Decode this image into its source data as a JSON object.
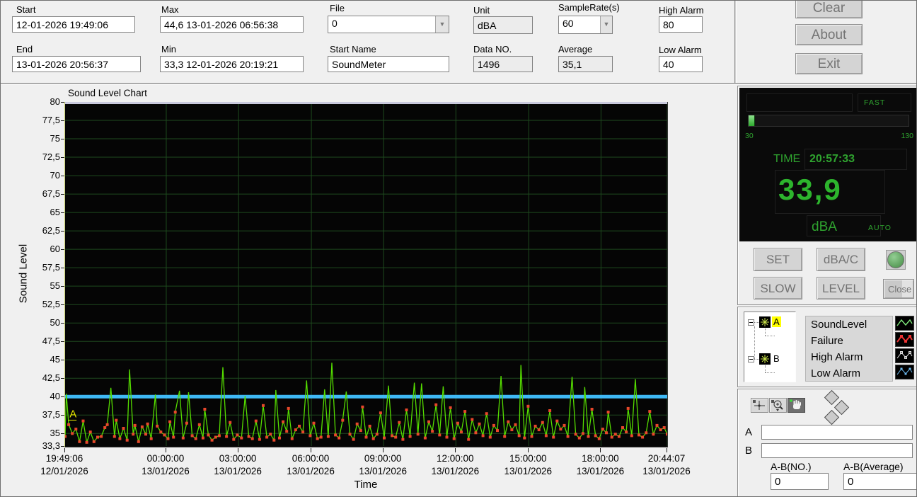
{
  "topbar": {
    "fields": {
      "start": {
        "label": "Start",
        "value": "12-01-2026 19:49:06"
      },
      "end": {
        "label": "End",
        "value": "13-01-2026 20:56:37"
      },
      "max": {
        "label": "Max",
        "value": "44,6 13-01-2026 06:56:38"
      },
      "min": {
        "label": "Min",
        "value": "33,3 12-01-2026 20:19:21"
      },
      "file": {
        "label": "File",
        "value": "0"
      },
      "start_name": {
        "label": "Start Name",
        "value": "SoundMeter"
      },
      "unit": {
        "label": "Unit",
        "value": "dBA"
      },
      "data_no": {
        "label": "Data NO.",
        "value": "1496"
      },
      "sample_rate": {
        "label": "SampleRate(s)",
        "value": "60"
      },
      "average": {
        "label": "Average",
        "value": "35,1"
      },
      "high_alarm": {
        "label": "High Alarm",
        "value": "80"
      },
      "low_alarm": {
        "label": "Low Alarm",
        "value": "40"
      }
    },
    "buttons": {
      "clear": "Clear",
      "about": "About",
      "exit": "Exit"
    }
  },
  "chart_data": {
    "type": "line",
    "title": "Sound Level Chart",
    "xlabel": "Time",
    "ylabel": "Sound Level",
    "ylim": [
      33.3,
      80
    ],
    "grid": true,
    "bg": "#050505",
    "grid_color": "#1e4a1e",
    "yticks": [
      {
        "label": "80",
        "value": 80
      },
      {
        "label": "77,5",
        "value": 77.5
      },
      {
        "label": "75",
        "value": 75
      },
      {
        "label": "72,5",
        "value": 72.5
      },
      {
        "label": "70",
        "value": 70
      },
      {
        "label": "67,5",
        "value": 67.5
      },
      {
        "label": "65",
        "value": 65
      },
      {
        "label": "62,5",
        "value": 62.5
      },
      {
        "label": "60",
        "value": 60
      },
      {
        "label": "57,5",
        "value": 57.5
      },
      {
        "label": "55",
        "value": 55
      },
      {
        "label": "52,5",
        "value": 52.5
      },
      {
        "label": "50",
        "value": 50
      },
      {
        "label": "47,5",
        "value": 47.5
      },
      {
        "label": "45",
        "value": 45
      },
      {
        "label": "42,5",
        "value": 42.5
      },
      {
        "label": "40",
        "value": 40
      },
      {
        "label": "37,5",
        "value": 37.5
      },
      {
        "label": "35",
        "value": 35
      },
      {
        "label": "33,3",
        "value": 33.3
      }
    ],
    "xticks": [
      {
        "time": "19:49:06",
        "date": "12/01/2026",
        "f": 0.0
      },
      {
        "time": "00:00:00",
        "date": "13/01/2026",
        "f": 0.168
      },
      {
        "time": "03:00:00",
        "date": "13/01/2026",
        "f": 0.288
      },
      {
        "time": "06:00:00",
        "date": "13/01/2026",
        "f": 0.409
      },
      {
        "time": "09:00:00",
        "date": "13/01/2026",
        "f": 0.529
      },
      {
        "time": "12:00:00",
        "date": "13/01/2026",
        "f": 0.649
      },
      {
        "time": "15:00:00",
        "date": "13/01/2026",
        "f": 0.77
      },
      {
        "time": "18:00:00",
        "date": "13/01/2026",
        "f": 0.89
      },
      {
        "time": "20:44:07",
        "date": "13/01/2026",
        "f": 1.0
      }
    ],
    "high_alarm_line": {
      "value": 80,
      "color": "#c9c9dd"
    },
    "low_alarm_line": {
      "value": 40,
      "color": "#3fb9f5"
    },
    "cursor_a": {
      "label": "A",
      "f": 0.012,
      "value": 37.2,
      "color": "#e8e800"
    },
    "series": [
      {
        "name": "SoundLevel",
        "color": "#55dd00",
        "marker_color": "#e8472b",
        "points": [
          [
            0.0,
            34.6
          ],
          [
            0.002,
            40.4
          ],
          [
            0.006,
            36.2
          ],
          [
            0.012,
            35.0
          ],
          [
            0.018,
            35.6
          ],
          [
            0.024,
            33.9
          ],
          [
            0.03,
            36.7
          ],
          [
            0.036,
            33.8
          ],
          [
            0.042,
            35.2
          ],
          [
            0.048,
            33.9
          ],
          [
            0.054,
            34.5
          ],
          [
            0.06,
            34.6
          ],
          [
            0.066,
            35.8
          ],
          [
            0.07,
            36.2
          ],
          [
            0.076,
            41.2
          ],
          [
            0.082,
            34.6
          ],
          [
            0.085,
            36.8
          ],
          [
            0.091,
            34.3
          ],
          [
            0.097,
            35.7
          ],
          [
            0.103,
            34.1
          ],
          [
            0.107,
            43.7
          ],
          [
            0.113,
            34.9
          ],
          [
            0.116,
            36.1
          ],
          [
            0.122,
            33.9
          ],
          [
            0.128,
            35.9
          ],
          [
            0.134,
            34.9
          ],
          [
            0.137,
            36.3
          ],
          [
            0.143,
            34.3
          ],
          [
            0.15,
            40.3
          ],
          [
            0.153,
            36.0
          ],
          [
            0.159,
            35.2
          ],
          [
            0.165,
            34.8
          ],
          [
            0.171,
            34.3
          ],
          [
            0.174,
            36.6
          ],
          [
            0.18,
            34.5
          ],
          [
            0.183,
            37.9
          ],
          [
            0.19,
            40.8
          ],
          [
            0.196,
            34.4
          ],
          [
            0.202,
            36.4
          ],
          [
            0.205,
            40.6
          ],
          [
            0.211,
            34.7
          ],
          [
            0.217,
            34.3
          ],
          [
            0.223,
            36.2
          ],
          [
            0.229,
            34.4
          ],
          [
            0.232,
            38.3
          ],
          [
            0.238,
            34.8
          ],
          [
            0.244,
            34.1
          ],
          [
            0.25,
            34.5
          ],
          [
            0.256,
            34.7
          ],
          [
            0.262,
            44.0
          ],
          [
            0.268,
            34.6
          ],
          [
            0.274,
            36.5
          ],
          [
            0.28,
            34.2
          ],
          [
            0.286,
            34.8
          ],
          [
            0.293,
            34.4
          ],
          [
            0.299,
            40.1
          ],
          [
            0.305,
            34.6
          ],
          [
            0.311,
            34.3
          ],
          [
            0.317,
            36.7
          ],
          [
            0.323,
            34.2
          ],
          [
            0.329,
            38.8
          ],
          [
            0.335,
            34.5
          ],
          [
            0.341,
            34.9
          ],
          [
            0.347,
            34.1
          ],
          [
            0.35,
            40.9
          ],
          [
            0.356,
            34.4
          ],
          [
            0.362,
            36.6
          ],
          [
            0.368,
            35.3
          ],
          [
            0.371,
            38.4
          ],
          [
            0.377,
            34.3
          ],
          [
            0.383,
            35.5
          ],
          [
            0.389,
            36.0
          ],
          [
            0.395,
            35.2
          ],
          [
            0.401,
            42.2
          ],
          [
            0.407,
            34.7
          ],
          [
            0.413,
            36.4
          ],
          [
            0.419,
            34.3
          ],
          [
            0.425,
            34.5
          ],
          [
            0.431,
            41.0
          ],
          [
            0.437,
            34.6
          ],
          [
            0.443,
            44.6
          ],
          [
            0.449,
            34.8
          ],
          [
            0.455,
            34.4
          ],
          [
            0.461,
            36.8
          ],
          [
            0.467,
            40.7
          ],
          [
            0.473,
            34.9
          ],
          [
            0.479,
            34.2
          ],
          [
            0.485,
            36.3
          ],
          [
            0.491,
            35.4
          ],
          [
            0.494,
            38.6
          ],
          [
            0.5,
            34.5
          ],
          [
            0.506,
            36.0
          ],
          [
            0.512,
            34.3
          ],
          [
            0.518,
            34.9
          ],
          [
            0.524,
            37.8
          ],
          [
            0.53,
            34.4
          ],
          [
            0.537,
            41.5
          ],
          [
            0.543,
            34.7
          ],
          [
            0.549,
            34.5
          ],
          [
            0.555,
            36.5
          ],
          [
            0.561,
            34.2
          ],
          [
            0.567,
            38.2
          ],
          [
            0.573,
            34.6
          ],
          [
            0.58,
            41.9
          ],
          [
            0.586,
            34.9
          ],
          [
            0.592,
            41.8
          ],
          [
            0.598,
            34.4
          ],
          [
            0.604,
            36.6
          ],
          [
            0.61,
            35.3
          ],
          [
            0.616,
            38.9
          ],
          [
            0.622,
            34.8
          ],
          [
            0.628,
            41.4
          ],
          [
            0.634,
            34.5
          ],
          [
            0.64,
            38.5
          ],
          [
            0.646,
            34.3
          ],
          [
            0.652,
            36.4
          ],
          [
            0.658,
            35.2
          ],
          [
            0.664,
            38.0
          ],
          [
            0.67,
            34.2
          ],
          [
            0.676,
            36.9
          ],
          [
            0.682,
            35.1
          ],
          [
            0.688,
            36.3
          ],
          [
            0.694,
            34.7
          ],
          [
            0.7,
            37.7
          ],
          [
            0.706,
            34.5
          ],
          [
            0.712,
            36.1
          ],
          [
            0.718,
            35.4
          ],
          [
            0.724,
            42.8
          ],
          [
            0.73,
            34.6
          ],
          [
            0.736,
            36.6
          ],
          [
            0.742,
            35.5
          ],
          [
            0.748,
            36.2
          ],
          [
            0.754,
            34.7
          ],
          [
            0.757,
            44.3
          ],
          [
            0.763,
            34.4
          ],
          [
            0.769,
            38.7
          ],
          [
            0.775,
            34.6
          ],
          [
            0.781,
            36.0
          ],
          [
            0.787,
            35.5
          ],
          [
            0.793,
            36.5
          ],
          [
            0.799,
            34.7
          ],
          [
            0.805,
            38.1
          ],
          [
            0.811,
            34.5
          ],
          [
            0.817,
            36.7
          ],
          [
            0.823,
            35.6
          ],
          [
            0.829,
            36.1
          ],
          [
            0.835,
            34.6
          ],
          [
            0.842,
            42.7
          ],
          [
            0.848,
            34.9
          ],
          [
            0.854,
            34.4
          ],
          [
            0.86,
            35.0
          ],
          [
            0.863,
            41.3
          ],
          [
            0.869,
            34.6
          ],
          [
            0.875,
            38.3
          ],
          [
            0.881,
            34.7
          ],
          [
            0.887,
            34.3
          ],
          [
            0.893,
            35.6
          ],
          [
            0.899,
            35.1
          ],
          [
            0.902,
            37.9
          ],
          [
            0.908,
            34.5
          ],
          [
            0.914,
            34.9
          ],
          [
            0.92,
            34.6
          ],
          [
            0.926,
            35.8
          ],
          [
            0.932,
            35.2
          ],
          [
            0.935,
            38.4
          ],
          [
            0.941,
            34.7
          ],
          [
            0.947,
            42.4
          ],
          [
            0.953,
            34.8
          ],
          [
            0.959,
            34.5
          ],
          [
            0.965,
            35.1
          ],
          [
            0.971,
            38.0
          ],
          [
            0.977,
            34.9
          ],
          [
            0.983,
            36.1
          ],
          [
            0.989,
            35.5
          ],
          [
            0.995,
            35.8
          ],
          [
            1.0,
            34.9
          ]
        ]
      }
    ]
  },
  "meter": {
    "mode": "FAST",
    "scale_min": "30",
    "scale_max": "130",
    "scale_min_num": 30,
    "scale_max_num": 130,
    "time_label": "TIME",
    "time_value": "20:57:33",
    "value": "33,9",
    "value_num": 33.9,
    "unit": "dBA",
    "range_mode": "AUTO",
    "accent_color": "#2fa32f",
    "buttons": {
      "set": "SET",
      "dbac": "dBA/C",
      "slow": "SLOW",
      "level": "LEVEL",
      "close": "Close"
    }
  },
  "legend": {
    "tree": {
      "node_a": "A",
      "node_b": "B",
      "node_a_highlight": "#ffff00"
    },
    "items": [
      {
        "label": "SoundLevel",
        "color": "#7ee87a",
        "style": "line"
      },
      {
        "label": "Failure",
        "color": "#ee3333",
        "style": "thick-markers"
      },
      {
        "label": "High Alarm",
        "color": "#dcdcdc",
        "style": "markers"
      },
      {
        "label": "Low Alarm",
        "color": "#6cb8ee",
        "style": "markers"
      }
    ]
  },
  "readout": {
    "icons": {
      "cursor_tool": "crosshair-icon",
      "zoom_tool": "magnifier-plus-icon",
      "pan_tool": "hand-icon",
      "nav": "diamond-pad-icon"
    },
    "a_label": "A",
    "a_value": "",
    "b_label": "B",
    "b_value": "",
    "ab_no_label": "A-B(NO.)",
    "ab_no_value": "0",
    "ab_avg_label": "A-B(Average)",
    "ab_avg_value": "0"
  }
}
